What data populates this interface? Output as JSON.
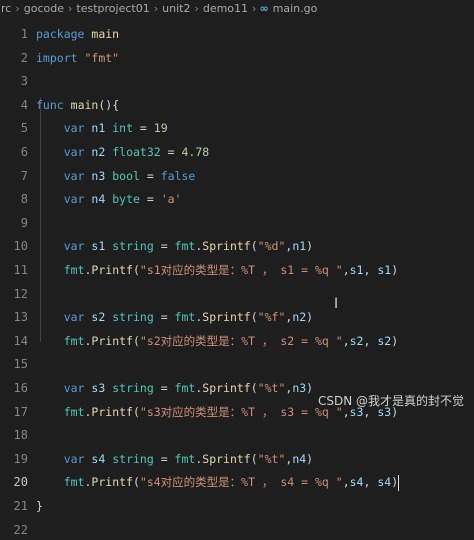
{
  "breadcrumb": {
    "items": [
      "rc",
      "gocode",
      "testproject01",
      "unit2",
      "demo11"
    ],
    "file_icon": "go-file-icon",
    "file_icon_text": "∞",
    "file": "main.go",
    "separator": "›"
  },
  "editor": {
    "line_numbers": [
      "1",
      "2",
      "3",
      "4",
      "5",
      "6",
      "7",
      "8",
      "9",
      "10",
      "11",
      "12",
      "13",
      "14",
      "15",
      "16",
      "17",
      "18",
      "19",
      "20",
      "21",
      "22"
    ],
    "active_line": "20",
    "code_lines": [
      "package main",
      "import \"fmt\"",
      "",
      "func main(){",
      "    var n1 int = 19",
      "    var n2 float32 = 4.78",
      "    var n3 bool = false",
      "    var n4 byte = 'a'",
      "",
      "    var s1 string = fmt.Sprintf(\"%d\",n1)",
      "    fmt.Printf(\"s1对应的类型是：%T ， s1 = %q \",s1, s1)",
      "",
      "    var s2 string = fmt.Sprintf(\"%f\",n2)",
      "    fmt.Printf(\"s2对应的类型是：%T ， s2 = %q \",s2, s2)",
      "",
      "    var s3 string = fmt.Sprintf(\"%t\",n3)",
      "    fmt.Printf(\"s3对应的类型是：%T ， s3 = %q \",s3, s3)",
      "",
      "    var s4 string = fmt.Sprintf(\"%t\",n4)",
      "    fmt.Printf(\"s4对应的类型是：%T ， s4 = %q \",s4, s4)",
      "}",
      ""
    ]
  },
  "watermark": "CSDN @我才是真的封不觉",
  "colors": {
    "background": "#1e1e1e",
    "keyword": "#569cd6",
    "function": "#dcdcaa",
    "string": "#ce9178",
    "number": "#b5cea8",
    "variable": "#9cdcfe",
    "type": "#4ec9b0"
  }
}
